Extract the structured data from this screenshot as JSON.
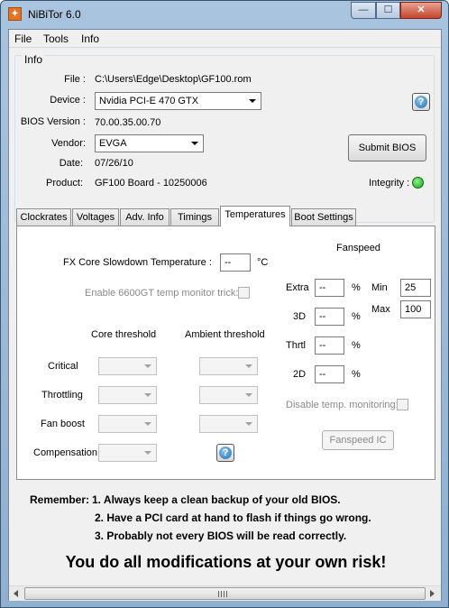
{
  "window": {
    "title": "NiBiTor 6.0",
    "min": "—",
    "max": "☐",
    "close": "✕"
  },
  "menu": [
    "File",
    "Tools",
    "Info"
  ],
  "info": {
    "group": "Info",
    "file_label": "File :",
    "file_value": "C:\\Users\\Edge\\Desktop\\GF100.rom",
    "device_label": "Device :",
    "device_value": "Nvidia PCI-E 470 GTX",
    "bios_label": "BIOS Version :",
    "bios_value": "70.00.35.00.70",
    "vendor_label": "Vendor:",
    "vendor_value": "EVGA",
    "date_label": "Date:",
    "date_value": "07/26/10",
    "product_label": "Product:",
    "product_value": "GF100 Board - 10250006",
    "submit": "Submit BIOS",
    "integrity_label": "Integrity :",
    "integrity_color": "#22b822"
  },
  "tabs": [
    "Clockrates",
    "Voltages",
    "Adv. Info",
    "Timings",
    "Temperatures",
    "Boot Settings"
  ],
  "active_tab": "Temperatures",
  "temps": {
    "slowdown_label": "FX Core Slowdown Temperature :",
    "slowdown_value": "--",
    "slowdown_unit": "°C",
    "enable_label": "Enable 6600GT temp monitor trick:",
    "core_header": "Core threshold",
    "ambient_header": "Ambient threshold",
    "rows": [
      "Critical",
      "Throttling",
      "Fan boost",
      "Compensation"
    ]
  },
  "fanspeed": {
    "title": "Fanspeed",
    "extra_label": "Extra",
    "extra_value": "--",
    "d3_label": "3D",
    "d3_value": "--",
    "thrtl_label": "Thrtl",
    "thrtl_value": "--",
    "d2_label": "2D",
    "d2_value": "--",
    "pct": "%",
    "min_label": "Min",
    "min_value": "25",
    "max_label": "Max",
    "max_value": "100",
    "disable_label": "Disable temp. monitoring:",
    "ic_button": "Fanspeed IC"
  },
  "remember": {
    "label": "Remember:",
    "line1": "1. Always keep a clean backup of your old BIOS.",
    "line2": "2. Have a PCI card at hand to flash if things go wrong.",
    "line3": "3. Probably not every BIOS will be read correctly.",
    "warning": "You do all modifications at your own risk!"
  },
  "scrollbar": {
    "grip": "|||"
  }
}
